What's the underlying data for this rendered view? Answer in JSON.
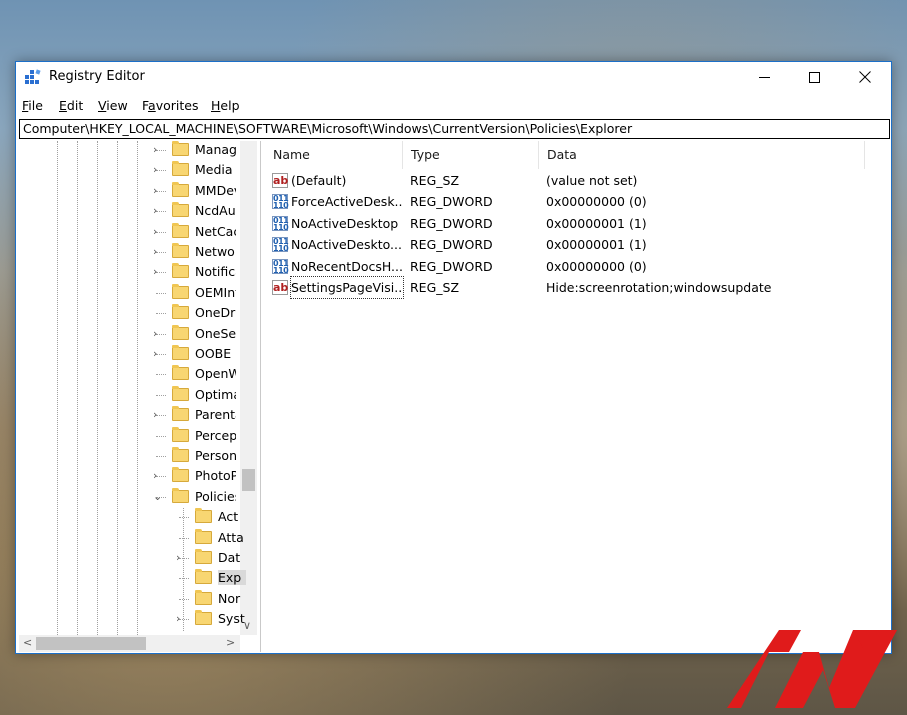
{
  "window": {
    "title": "Registry Editor"
  },
  "menu": [
    "File",
    "Edit",
    "View",
    "Favorites",
    "Help"
  ],
  "menu_underline": [
    "F",
    "E",
    "V",
    "a",
    "H"
  ],
  "address": "Computer\\HKEY_LOCAL_MACHINE\\SOFTWARE\\Microsoft\\Windows\\CurrentVersion\\Policies\\Explorer",
  "tree": {
    "items": [
      {
        "label": "Manag",
        "expander": "›",
        "level": 0
      },
      {
        "label": "Media C",
        "expander": "›",
        "level": 0
      },
      {
        "label": "MMDev",
        "expander": "›",
        "level": 0
      },
      {
        "label": "NcdAu",
        "expander": "›",
        "level": 0
      },
      {
        "label": "NetCac",
        "expander": "›",
        "level": 0
      },
      {
        "label": "Networ",
        "expander": "›",
        "level": 0
      },
      {
        "label": "Notifica",
        "expander": "›",
        "level": 0
      },
      {
        "label": "OEMInf",
        "expander": "",
        "level": 0
      },
      {
        "label": "OneDri",
        "expander": "",
        "level": 0
      },
      {
        "label": "OneSet",
        "expander": "›",
        "level": 0
      },
      {
        "label": "OOBE",
        "expander": "›",
        "level": 0
      },
      {
        "label": "OpenW",
        "expander": "",
        "level": 0
      },
      {
        "label": "Optima",
        "expander": "",
        "level": 0
      },
      {
        "label": "Parenta",
        "expander": "›",
        "level": 0
      },
      {
        "label": "Percept",
        "expander": "",
        "level": 0
      },
      {
        "label": "Persona",
        "expander": "",
        "level": 0
      },
      {
        "label": "PhotoP",
        "expander": "›",
        "level": 0
      },
      {
        "label": "Policies",
        "expander": "⌄",
        "level": 0
      },
      {
        "label": "Act",
        "expander": "",
        "level": 1
      },
      {
        "label": "Atta",
        "expander": "",
        "level": 1
      },
      {
        "label": "Dat",
        "expander": "›",
        "level": 1
      },
      {
        "label": "Exp",
        "expander": "",
        "level": 1,
        "selected": true
      },
      {
        "label": "Nor",
        "expander": "",
        "level": 1
      },
      {
        "label": "Syst",
        "expander": "›",
        "level": 1
      }
    ]
  },
  "list": {
    "columns": [
      "Name",
      "Type",
      "Data"
    ],
    "rows": [
      {
        "icon": "string-value-icon",
        "glyph": "ab",
        "name": "(Default)",
        "type": "REG_SZ",
        "data": "(value not set)"
      },
      {
        "icon": "dword-value-icon",
        "glyph": "011\n110",
        "name": "ForceActiveDesk...",
        "type": "REG_DWORD",
        "data": "0x00000000 (0)"
      },
      {
        "icon": "dword-value-icon",
        "glyph": "011\n110",
        "name": "NoActiveDesktop",
        "type": "REG_DWORD",
        "data": "0x00000001 (1)"
      },
      {
        "icon": "dword-value-icon",
        "glyph": "011\n110",
        "name": "NoActiveDeskto...",
        "type": "REG_DWORD",
        "data": "0x00000001 (1)"
      },
      {
        "icon": "dword-value-icon",
        "glyph": "011\n110",
        "name": "NoRecentDocsH...",
        "type": "REG_DWORD",
        "data": "0x00000000 (0)"
      },
      {
        "icon": "string-value-icon",
        "glyph": "ab",
        "name": "SettingsPageVisi...",
        "type": "REG_SZ",
        "data": "Hide:screenrotation;windowsupdate",
        "focused": true
      }
    ]
  },
  "colors": {
    "window_border": "#1b6fc8",
    "logo_red": "#e01b1b",
    "folder": "#f8d672"
  }
}
